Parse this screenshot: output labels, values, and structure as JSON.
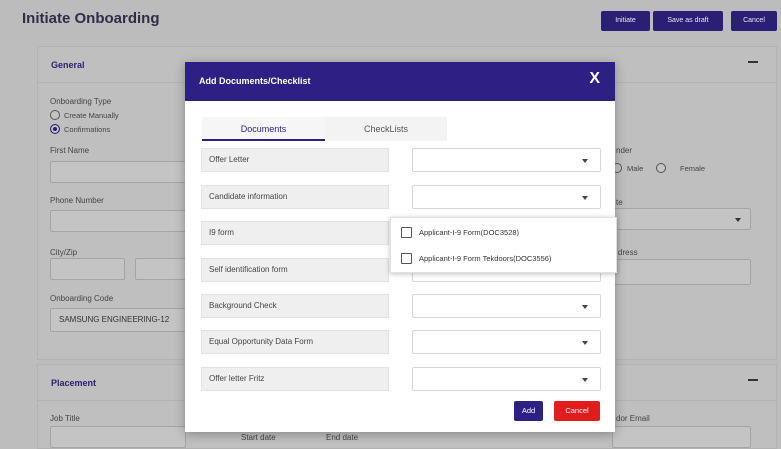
{
  "page": {
    "title": "Initiate Onboarding",
    "actions": [
      {
        "label": "Initiate"
      },
      {
        "label": "Save as draft"
      },
      {
        "label": "Cancel"
      }
    ]
  },
  "general": {
    "title": "General",
    "onboarding_type_label": "Onboarding Type",
    "onboarding_options": [
      "Create Manually",
      "Confirmations"
    ],
    "selected_onboarding": "Confirmations",
    "first_name_label": "First Name",
    "phone_label": "Phone Number",
    "city_zip_label": "City/Zip",
    "onboarding_code_label": "Onboarding Code",
    "onboarding_code_value": "SAMSUNG ENGINEERING-12",
    "gender_label_partial": "nder",
    "gender_options": [
      "Male",
      "Female"
    ],
    "partial_label_te": "te",
    "partial_label_dress": "dress"
  },
  "placement": {
    "title": "Placement",
    "job_title_label": "Job Title",
    "vendor_email_label_partial": "dor Email",
    "start_date_placeholder": "Start date",
    "end_date_placeholder": "End date"
  },
  "modal": {
    "title": "Add Documents/Checklist",
    "close_label": "X",
    "tabs": [
      {
        "label": "Documents",
        "active": true
      },
      {
        "label": "CheckLists",
        "active": false
      }
    ],
    "rows": [
      {
        "label": "Offer Letter"
      },
      {
        "label": "Candidate information"
      },
      {
        "label": "I9 form"
      },
      {
        "label": "Self identification form"
      },
      {
        "label": "Background Check"
      },
      {
        "label": "Equal Opportunity Data Form"
      },
      {
        "label": "Offer letter Fritz"
      }
    ],
    "dropdown_options": [
      "Applicant-I-9 Form(DOC3528)",
      "Applicant-I-9 Form Tekdoors(DOC3556)"
    ],
    "add_label": "Add",
    "cancel_label": "Cancel"
  },
  "colors": {
    "primary": "#2d1f84",
    "danger": "#e01c1c",
    "overlay_bg": "#bdbdbd"
  }
}
